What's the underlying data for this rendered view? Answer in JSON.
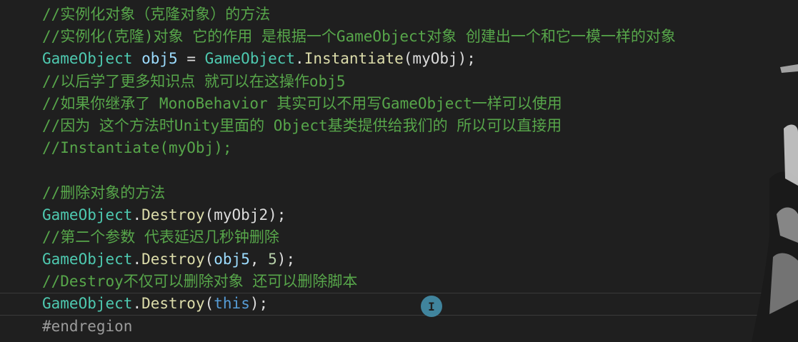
{
  "code_lines": [
    [
      {
        "t": "//实例化对象（克隆对象）的方法",
        "c": "cmt"
      }
    ],
    [
      {
        "t": "//实例化(克隆)对象 它的作用 是根据一个GameObject对象 创建出一个和它一模一样的对象",
        "c": "cmt"
      }
    ],
    [
      {
        "t": "GameObject",
        "c": "type"
      },
      {
        "t": " ",
        "c": "plain"
      },
      {
        "t": "obj5",
        "c": "ident"
      },
      {
        "t": " = ",
        "c": "plain"
      },
      {
        "t": "GameObject",
        "c": "type"
      },
      {
        "t": ".",
        "c": "plain"
      },
      {
        "t": "Instantiate",
        "c": "method"
      },
      {
        "t": "(myObj);",
        "c": "plain"
      }
    ],
    [
      {
        "t": "//以后学了更多知识点 就可以在这操作obj5",
        "c": "cmt"
      }
    ],
    [
      {
        "t": "//如果你继承了 MonoBehavior 其实可以不用写GameObject一样可以使用",
        "c": "cmt"
      }
    ],
    [
      {
        "t": "//因为 这个方法时Unity里面的 Object基类提供给我们的 所以可以直接用",
        "c": "cmt"
      }
    ],
    [
      {
        "t": "//Instantiate(myObj);",
        "c": "cmt"
      }
    ],
    [],
    [
      {
        "t": "//删除对象的方法",
        "c": "cmt"
      }
    ],
    [
      {
        "t": "GameObject",
        "c": "type"
      },
      {
        "t": ".",
        "c": "plain"
      },
      {
        "t": "Destroy",
        "c": "method"
      },
      {
        "t": "(myObj2);",
        "c": "plain"
      }
    ],
    [
      {
        "t": "//第二个参数 代表延迟几秒钟删除",
        "c": "cmt"
      }
    ],
    [
      {
        "t": "GameObject",
        "c": "type"
      },
      {
        "t": ".",
        "c": "plain"
      },
      {
        "t": "Destroy",
        "c": "method"
      },
      {
        "t": "(",
        "c": "plain"
      },
      {
        "t": "obj5",
        "c": "ident"
      },
      {
        "t": ", ",
        "c": "plain"
      },
      {
        "t": "5",
        "c": "num"
      },
      {
        "t": ");",
        "c": "plain"
      }
    ],
    [
      {
        "t": "//Destroy不仅可以删除对象 还可以删除脚本",
        "c": "cmt"
      }
    ],
    [
      {
        "t": "GameObject",
        "c": "type"
      },
      {
        "t": ".",
        "c": "plain"
      },
      {
        "t": "Destroy",
        "c": "method"
      },
      {
        "t": "(",
        "c": "plain"
      },
      {
        "t": "this",
        "c": "kw"
      },
      {
        "t": ");",
        "c": "plain"
      }
    ],
    [
      {
        "t": "#endregion",
        "c": "pre"
      }
    ]
  ],
  "current_line_index": 13,
  "cursor_icon": "text-cursor-icon",
  "colors": {
    "background": "#1f1f1f",
    "comment": "#57a64a",
    "type": "#4ec9b0",
    "identifier": "#9cdcfe",
    "method": "#dcdcaa",
    "keyword": "#569cd6",
    "number": "#b5cea8"
  }
}
